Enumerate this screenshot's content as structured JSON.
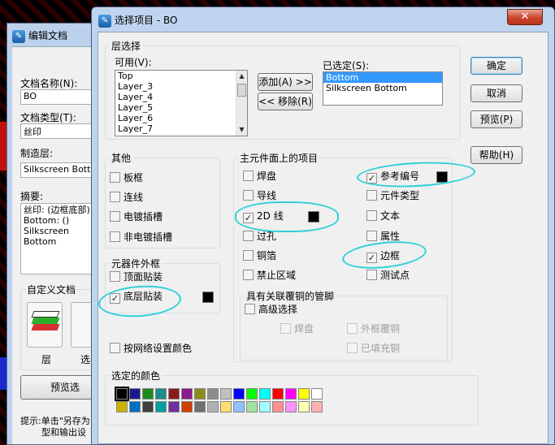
{
  "back_window": {
    "title": "编辑文档",
    "doc_name_label": "文档名称(N):",
    "doc_name_value": "BO",
    "doc_type_label": "文档类型(T):",
    "doc_type_value": "丝印",
    "layer_label": "制造层:",
    "layer_value": "Silkscreen Bottom",
    "summary_label": "摘要:",
    "summary_lines": [
      "丝印: (边框底部)",
      "Bottom: ()",
      "Silkscreen Bottom"
    ],
    "custom_doc_label": "自定义文档",
    "layers_label": "层",
    "select_label": "选",
    "preview_label": "预览选",
    "hint_line1": "提示:单击\"另存为",
    "hint_line2": "型和输出设"
  },
  "dialog": {
    "title": "选择项目 - BO",
    "close_glyph": "✕",
    "layer_select_title": "层选择",
    "available_label": "可用(V):",
    "available_items": [
      "Top",
      "Layer_3",
      "Layer_4",
      "Layer_5",
      "Layer_6",
      "Layer_7"
    ],
    "add_button": "添加(A) >>",
    "remove_button": "<< 移除(R)",
    "selected_label": "已选定(S):",
    "selected_items": [
      "Bottom",
      "Silkscreen Bottom"
    ],
    "ok_button": "确定",
    "cancel_button": "取消",
    "preview_button": "预览(P)",
    "help_button": "帮助(H)",
    "other_title": "其他",
    "other_items": [
      "板框",
      "连线",
      "电镀插槽",
      "非电镀插槽"
    ],
    "outline_title": "元器件外框",
    "outline_items": [
      {
        "label": "顶面贴装",
        "checked": false
      },
      {
        "label": "底层贴装",
        "checked": true
      }
    ],
    "net_color_label": "按网络设置颜色",
    "main_title": "主元件面上的项目",
    "main_col1": [
      {
        "label": "焊盘",
        "checked": false
      },
      {
        "label": "导线",
        "checked": false
      },
      {
        "label": "2D 线",
        "checked": true
      },
      {
        "label": "过孔",
        "checked": false
      },
      {
        "label": "铜箔",
        "checked": false
      },
      {
        "label": "禁止区域",
        "checked": false
      }
    ],
    "main_col2": [
      {
        "label": "参考编号",
        "checked": true
      },
      {
        "label": "元件类型",
        "checked": false
      },
      {
        "label": "文本",
        "checked": false
      },
      {
        "label": "属性",
        "checked": false
      },
      {
        "label": "边框",
        "checked": true
      },
      {
        "label": "测试点",
        "checked": false
      }
    ],
    "pin_title": "具有关联覆铜的管脚",
    "advanced_label": "高级选择",
    "pad_label": "焊盘",
    "outline_copper_label": "外框覆铜",
    "filled_copper_label": "已填充铜",
    "color_title": "选定的颜色",
    "check_glyph": "✓",
    "palette_row1": [
      "#000000",
      "#1a1a8c",
      "#1a8c1a",
      "#1a8c8c",
      "#8c1a1a",
      "#8c1a8c",
      "#8c8c1a",
      "#8c8c8c",
      "#c0c0c0",
      "#0000ff",
      "#00ff00",
      "#00ffff",
      "#ff0000",
      "#ff00ff",
      "#ffff00",
      "#ffffff"
    ],
    "palette_row2": [
      "#c8b400",
      "#0070c0",
      "#404040",
      "#00a0a0",
      "#7030a0",
      "#d04000",
      "#707070",
      "#b0b0b0",
      "#ffe070",
      "#90c0ff",
      "#a0e0a0",
      "#a0ffff",
      "#ff9090",
      "#ff90ff",
      "#ffffb0",
      "#ffb0b0"
    ]
  }
}
